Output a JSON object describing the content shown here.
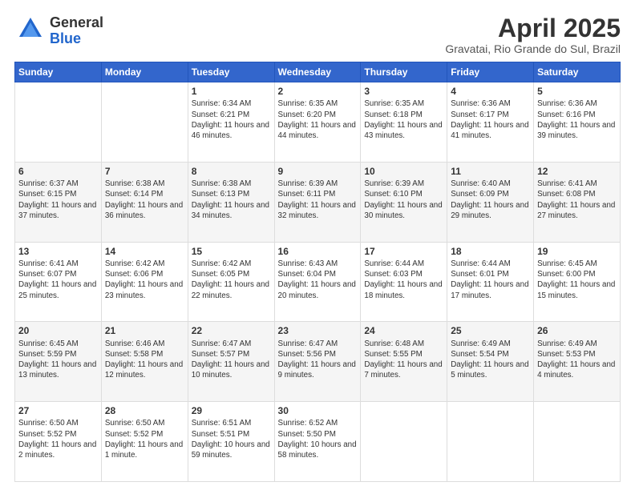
{
  "header": {
    "logo_general": "General",
    "logo_blue": "Blue",
    "month_title": "April 2025",
    "location": "Gravatai, Rio Grande do Sul, Brazil"
  },
  "weekdays": [
    "Sunday",
    "Monday",
    "Tuesday",
    "Wednesday",
    "Thursday",
    "Friday",
    "Saturday"
  ],
  "weeks": [
    [
      {
        "day": "",
        "detail": ""
      },
      {
        "day": "",
        "detail": ""
      },
      {
        "day": "1",
        "detail": "Sunrise: 6:34 AM\nSunset: 6:21 PM\nDaylight: 11 hours and 46 minutes."
      },
      {
        "day": "2",
        "detail": "Sunrise: 6:35 AM\nSunset: 6:20 PM\nDaylight: 11 hours and 44 minutes."
      },
      {
        "day": "3",
        "detail": "Sunrise: 6:35 AM\nSunset: 6:18 PM\nDaylight: 11 hours and 43 minutes."
      },
      {
        "day": "4",
        "detail": "Sunrise: 6:36 AM\nSunset: 6:17 PM\nDaylight: 11 hours and 41 minutes."
      },
      {
        "day": "5",
        "detail": "Sunrise: 6:36 AM\nSunset: 6:16 PM\nDaylight: 11 hours and 39 minutes."
      }
    ],
    [
      {
        "day": "6",
        "detail": "Sunrise: 6:37 AM\nSunset: 6:15 PM\nDaylight: 11 hours and 37 minutes."
      },
      {
        "day": "7",
        "detail": "Sunrise: 6:38 AM\nSunset: 6:14 PM\nDaylight: 11 hours and 36 minutes."
      },
      {
        "day": "8",
        "detail": "Sunrise: 6:38 AM\nSunset: 6:13 PM\nDaylight: 11 hours and 34 minutes."
      },
      {
        "day": "9",
        "detail": "Sunrise: 6:39 AM\nSunset: 6:11 PM\nDaylight: 11 hours and 32 minutes."
      },
      {
        "day": "10",
        "detail": "Sunrise: 6:39 AM\nSunset: 6:10 PM\nDaylight: 11 hours and 30 minutes."
      },
      {
        "day": "11",
        "detail": "Sunrise: 6:40 AM\nSunset: 6:09 PM\nDaylight: 11 hours and 29 minutes."
      },
      {
        "day": "12",
        "detail": "Sunrise: 6:41 AM\nSunset: 6:08 PM\nDaylight: 11 hours and 27 minutes."
      }
    ],
    [
      {
        "day": "13",
        "detail": "Sunrise: 6:41 AM\nSunset: 6:07 PM\nDaylight: 11 hours and 25 minutes."
      },
      {
        "day": "14",
        "detail": "Sunrise: 6:42 AM\nSunset: 6:06 PM\nDaylight: 11 hours and 23 minutes."
      },
      {
        "day": "15",
        "detail": "Sunrise: 6:42 AM\nSunset: 6:05 PM\nDaylight: 11 hours and 22 minutes."
      },
      {
        "day": "16",
        "detail": "Sunrise: 6:43 AM\nSunset: 6:04 PM\nDaylight: 11 hours and 20 minutes."
      },
      {
        "day": "17",
        "detail": "Sunrise: 6:44 AM\nSunset: 6:03 PM\nDaylight: 11 hours and 18 minutes."
      },
      {
        "day": "18",
        "detail": "Sunrise: 6:44 AM\nSunset: 6:01 PM\nDaylight: 11 hours and 17 minutes."
      },
      {
        "day": "19",
        "detail": "Sunrise: 6:45 AM\nSunset: 6:00 PM\nDaylight: 11 hours and 15 minutes."
      }
    ],
    [
      {
        "day": "20",
        "detail": "Sunrise: 6:45 AM\nSunset: 5:59 PM\nDaylight: 11 hours and 13 minutes."
      },
      {
        "day": "21",
        "detail": "Sunrise: 6:46 AM\nSunset: 5:58 PM\nDaylight: 11 hours and 12 minutes."
      },
      {
        "day": "22",
        "detail": "Sunrise: 6:47 AM\nSunset: 5:57 PM\nDaylight: 11 hours and 10 minutes."
      },
      {
        "day": "23",
        "detail": "Sunrise: 6:47 AM\nSunset: 5:56 PM\nDaylight: 11 hours and 9 minutes."
      },
      {
        "day": "24",
        "detail": "Sunrise: 6:48 AM\nSunset: 5:55 PM\nDaylight: 11 hours and 7 minutes."
      },
      {
        "day": "25",
        "detail": "Sunrise: 6:49 AM\nSunset: 5:54 PM\nDaylight: 11 hours and 5 minutes."
      },
      {
        "day": "26",
        "detail": "Sunrise: 6:49 AM\nSunset: 5:53 PM\nDaylight: 11 hours and 4 minutes."
      }
    ],
    [
      {
        "day": "27",
        "detail": "Sunrise: 6:50 AM\nSunset: 5:52 PM\nDaylight: 11 hours and 2 minutes."
      },
      {
        "day": "28",
        "detail": "Sunrise: 6:50 AM\nSunset: 5:52 PM\nDaylight: 11 hours and 1 minute."
      },
      {
        "day": "29",
        "detail": "Sunrise: 6:51 AM\nSunset: 5:51 PM\nDaylight: 10 hours and 59 minutes."
      },
      {
        "day": "30",
        "detail": "Sunrise: 6:52 AM\nSunset: 5:50 PM\nDaylight: 10 hours and 58 minutes."
      },
      {
        "day": "",
        "detail": ""
      },
      {
        "day": "",
        "detail": ""
      },
      {
        "day": "",
        "detail": ""
      }
    ]
  ]
}
